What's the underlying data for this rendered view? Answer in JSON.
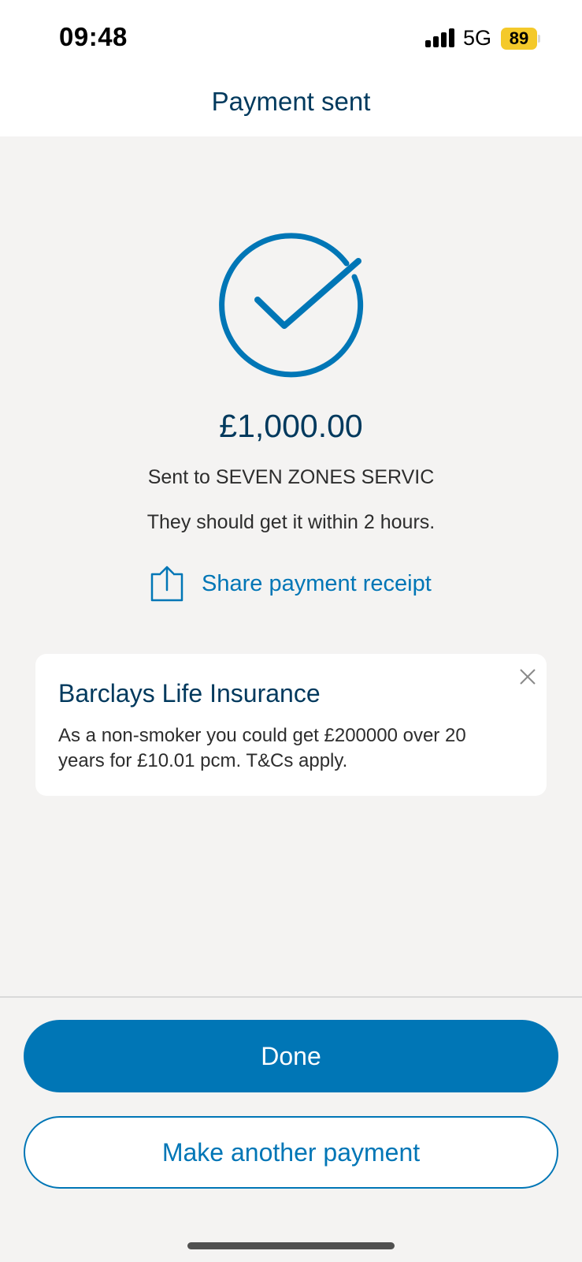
{
  "status_bar": {
    "time": "09:48",
    "network": "5G",
    "battery": "89",
    "icons": [
      "signal-bars-icon",
      "battery-icon"
    ]
  },
  "header": {
    "title": "Payment sent"
  },
  "confirmation": {
    "icon": "check-circle-icon",
    "amount": "£1,000.00",
    "recipient_line": "Sent to SEVEN ZONES SERVIC",
    "eta": "They should get it within 2 hours.",
    "share_label": "Share payment receipt",
    "share_icon": "share-icon"
  },
  "promo": {
    "title": "Barclays Life Insurance",
    "body": "As a non-smoker you could get £200000 over 20 years for £10.01 pcm. T&Cs apply.",
    "close_icon": "close-icon"
  },
  "actions": {
    "done_label": "Done",
    "another_label": "Make another payment"
  },
  "colors": {
    "primary": "#0076b6",
    "navy": "#00395d",
    "background": "#f4f3f2",
    "battery": "#f4c92a"
  }
}
